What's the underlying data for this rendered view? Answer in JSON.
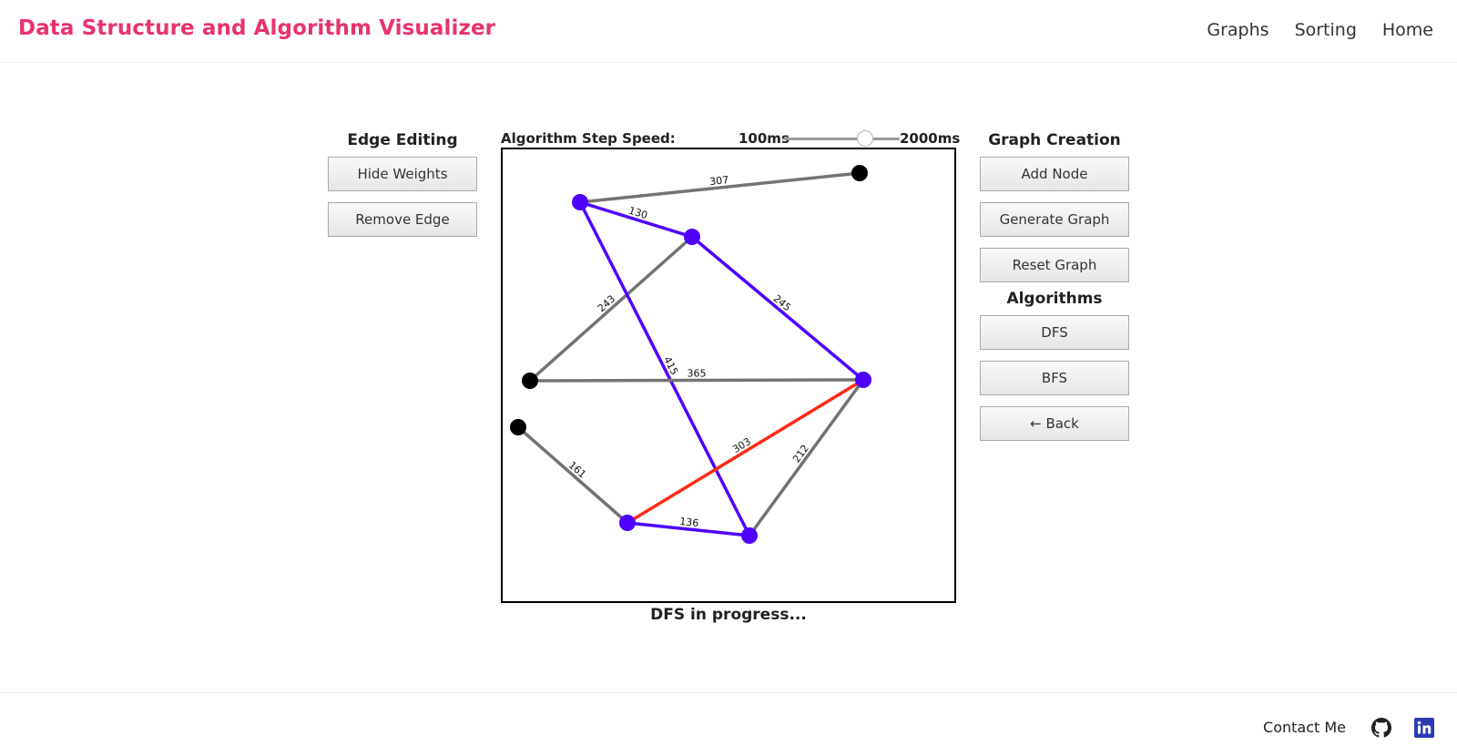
{
  "header": {
    "brand": "Data Structure and Algorithm Visualizer",
    "nav": [
      "Graphs",
      "Sorting",
      "Home"
    ]
  },
  "edge_editing": {
    "title": "Edge Editing",
    "buttons": [
      "Hide Weights",
      "Remove Edge"
    ]
  },
  "speed": {
    "label": "Algorithm Step Speed:",
    "min_label": "100ms",
    "max_label": "2000ms",
    "value_fraction": 0.7
  },
  "graph_creation": {
    "title": "Graph Creation",
    "buttons": [
      "Add Node",
      "Generate Graph",
      "Reset Graph"
    ]
  },
  "algorithms": {
    "title": "Algorithms",
    "buttons": [
      "DFS",
      "BFS",
      "← Back"
    ]
  },
  "status": "DFS in progress...",
  "footer": {
    "contact": "Contact Me",
    "icons": [
      "github-icon",
      "linkedin-icon"
    ]
  },
  "colors": {
    "brand": "#e8336b",
    "visited": "#4f00ff",
    "unvisited_node": "#000000",
    "default_edge": "#737373",
    "current_edge": "#ff2a16"
  },
  "graph": {
    "nodes": [
      {
        "id": "n1",
        "state": "unvisited"
      },
      {
        "id": "n2",
        "state": "visited"
      },
      {
        "id": "n3",
        "state": "visited"
      },
      {
        "id": "n4",
        "state": "unvisited"
      },
      {
        "id": "n5",
        "state": "visited"
      },
      {
        "id": "n6",
        "state": "unvisited"
      },
      {
        "id": "n7",
        "state": "visited"
      },
      {
        "id": "n8",
        "state": "visited"
      }
    ],
    "edges": [
      {
        "from": "n2",
        "to": "n1",
        "weight": "307",
        "state": "default"
      },
      {
        "from": "n2",
        "to": "n3",
        "weight": "130",
        "state": "visited"
      },
      {
        "from": "n3",
        "to": "n4",
        "weight": "243",
        "state": "default"
      },
      {
        "from": "n3",
        "to": "n5",
        "weight": "245",
        "state": "visited"
      },
      {
        "from": "n2",
        "to": "n8",
        "weight": "415",
        "state": "visited"
      },
      {
        "from": "n4",
        "to": "n5",
        "weight": "365",
        "state": "default"
      },
      {
        "from": "n5",
        "to": "n7",
        "weight": "303",
        "state": "current"
      },
      {
        "from": "n5",
        "to": "n8",
        "weight": "212",
        "state": "default"
      },
      {
        "from": "n6",
        "to": "n7",
        "weight": "161",
        "state": "default"
      },
      {
        "from": "n7",
        "to": "n8",
        "weight": "136",
        "state": "visited"
      }
    ]
  }
}
